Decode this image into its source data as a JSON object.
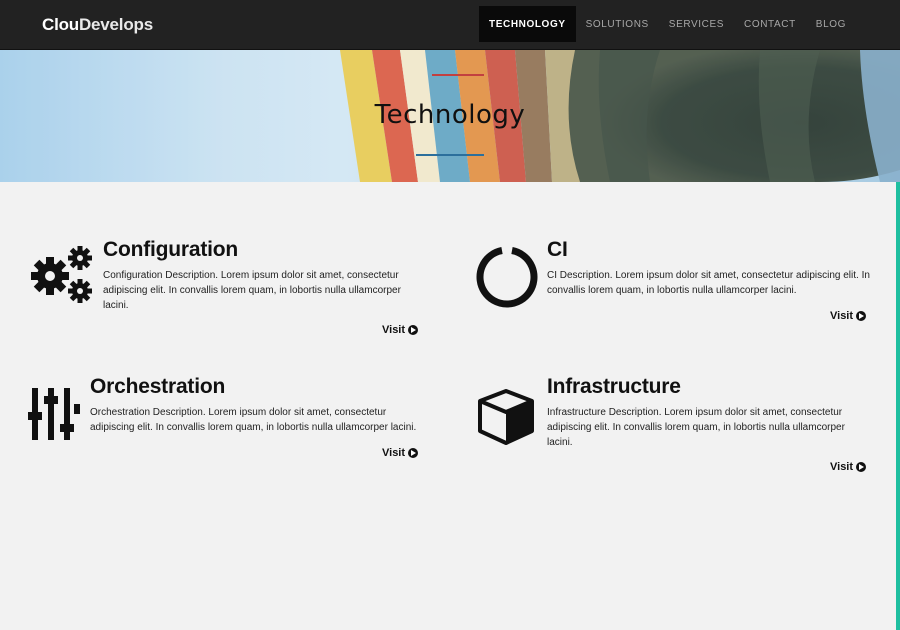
{
  "brand": {
    "part1": "Clou",
    "part2": "Develops"
  },
  "nav": {
    "items": [
      {
        "label": "TECHNOLOGY",
        "active": true
      },
      {
        "label": "SOLUTIONS",
        "active": false
      },
      {
        "label": "SERVICES",
        "active": false
      },
      {
        "label": "CONTACT",
        "active": false
      },
      {
        "label": "BLOG",
        "active": false
      }
    ]
  },
  "hero": {
    "title": "Technology"
  },
  "features": [
    {
      "title": "Configuration",
      "icon": "gears-icon",
      "description": "Configuration Description. Lorem ipsum dolor sit amet, consectetur adipiscing elit. In convallis lorem quam, in lobortis nulla ullamcorper lacini.",
      "visit": "Visit"
    },
    {
      "title": "CI",
      "icon": "ring-icon",
      "description": "CI Description. Lorem ipsum dolor sit amet, consectetur adipiscing elit. In convallis lorem quam, in lobortis nulla ullamcorper lacini.",
      "visit": "Visit"
    },
    {
      "title": "Orchestration",
      "icon": "sliders-icon",
      "description": "Orchestration Description. Lorem ipsum dolor sit amet, consectetur adipiscing elit. In convallis lorem quam, in lobortis nulla ullamcorper lacini.",
      "visit": "Visit"
    },
    {
      "title": "Infrastructure",
      "icon": "cube-icon",
      "description": "Infrastructure Description. Lorem ipsum dolor sit amet, consectetur adipiscing elit. In convallis lorem quam, in lobortis nulla ullamcorper lacini.",
      "visit": "Visit"
    }
  ],
  "colors": {
    "navbar": "#222222",
    "accent": "#1fbfa0",
    "heroLineTop": "#c24040",
    "heroLineBottom": "#2c6f9c"
  }
}
